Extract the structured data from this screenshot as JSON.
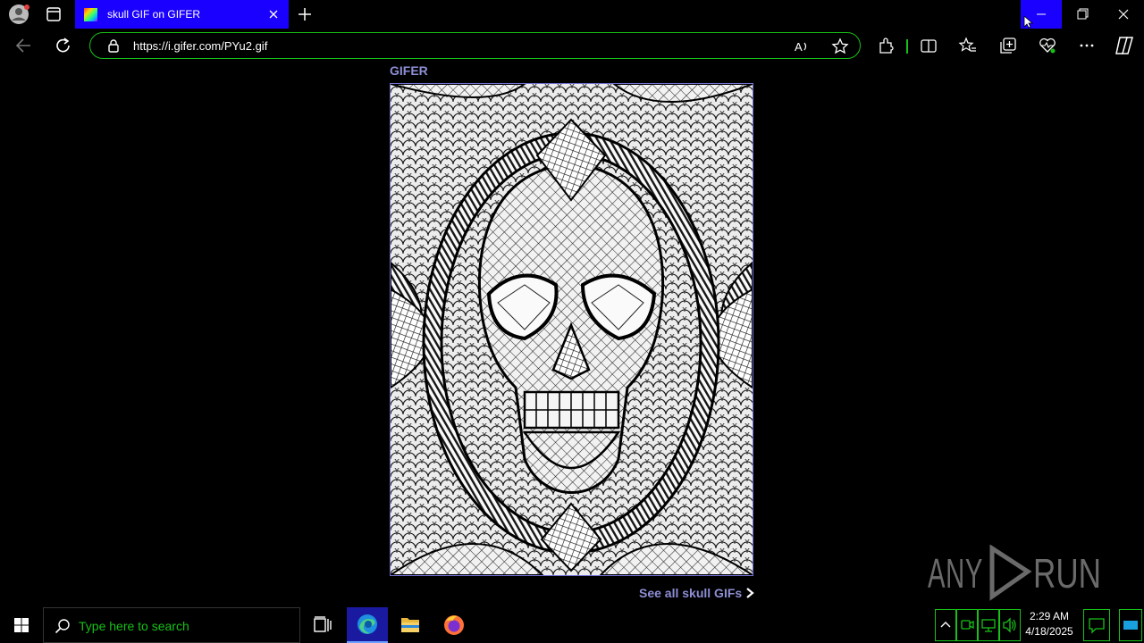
{
  "browser": {
    "tab": {
      "title": "skull GIF on GIFER"
    },
    "address": {
      "url": "https://i.gifer.com/PYu2.gif"
    }
  },
  "page": {
    "site_label": "GIFER",
    "image_alt_icon": "skull-zentangle-gif",
    "see_all_link": "See all skull GIFs"
  },
  "watermark": {
    "text": "ANY RUN"
  },
  "taskbar": {
    "search_placeholder": "Type here to search",
    "clock_time": "2:29 AM",
    "clock_date": "4/18/2025"
  },
  "colors": {
    "tab_active": "#1a00ff",
    "accent_green": "#18c018",
    "link": "#8e8ed6",
    "background": "#000000"
  }
}
